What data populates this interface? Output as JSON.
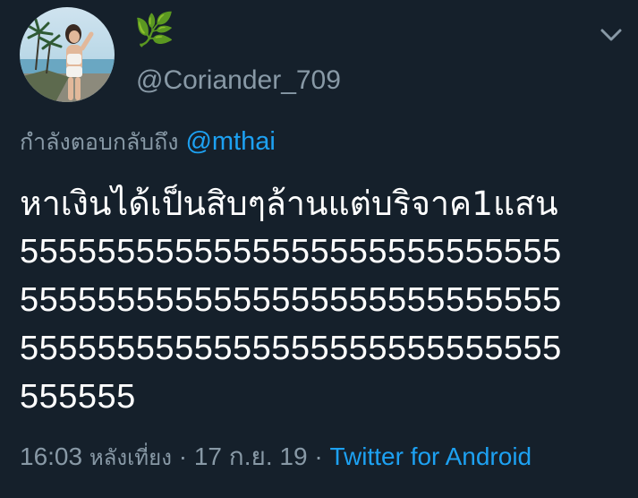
{
  "tweet": {
    "display_name": "🌿",
    "handle": "@Coriander_709",
    "menu_icon": "chevron-down-icon",
    "reply": {
      "prefix": "กำลังตอบกลับถึง",
      "mention": "@mthai"
    },
    "text_lines": [
      "หาเงินได้เป็นสิบๆล้านแต่บริจาค1แสน",
      "5555555555555555555555555555",
      "5555555555555555555555555555",
      "5555555555555555555555555555",
      "555555"
    ],
    "time": "16:03",
    "time_of_day": "หลังเที่ยง",
    "date": "17 ก.ย. 19",
    "separator": "·",
    "source": "Twitter for Android"
  },
  "colors": {
    "background": "#15202b",
    "muted": "#8899a6",
    "accent": "#1da1f2",
    "text": "#ffffff",
    "name_emoji": "#6fbf4a"
  }
}
